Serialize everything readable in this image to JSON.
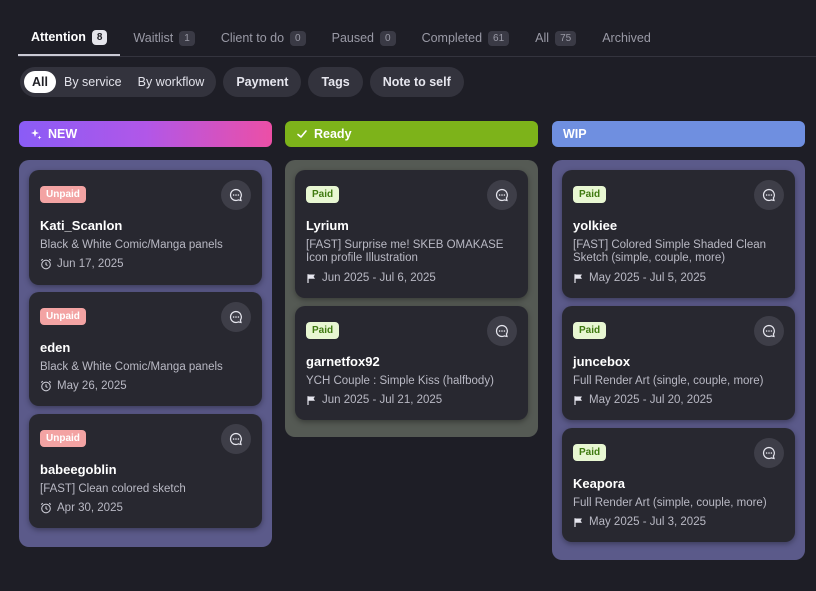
{
  "tabs": [
    {
      "label": "Attention",
      "count": "8",
      "active": true
    },
    {
      "label": "Waitlist",
      "count": "1"
    },
    {
      "label": "Client to do",
      "count": "0"
    },
    {
      "label": "Paused",
      "count": "0"
    },
    {
      "label": "Completed",
      "count": "61"
    },
    {
      "label": "All",
      "count": "75"
    },
    {
      "label": "Archived",
      "count": ""
    }
  ],
  "filters": {
    "segment": [
      "All",
      "By service",
      "By workflow"
    ],
    "pills": [
      "Payment",
      "Tags",
      "Note to self"
    ]
  },
  "columns": {
    "new": {
      "title": "NEW",
      "icon": "sparkle-icon",
      "cards": [
        {
          "badge": "Unpaid",
          "name": "Kati_Scanlon",
          "service": "Black & White Comic/Manga panels",
          "date": "Jun 17, 2025"
        },
        {
          "badge": "Unpaid",
          "name": "eden",
          "service": "Black & White Comic/Manga panels",
          "date": "May 26, 2025"
        },
        {
          "badge": "Unpaid",
          "name": "babeegoblin",
          "service": "[FAST] Clean colored sketch",
          "date": "Apr 30, 2025"
        }
      ]
    },
    "ready": {
      "title": "Ready",
      "icon": "check-icon",
      "cards": [
        {
          "badge": "Paid",
          "name": "Lyrium",
          "service": "[FAST] Surprise me! SKEB OMAKASE Icon profile Illustration",
          "date": "Jun 2025 - Jul 6, 2025"
        },
        {
          "badge": "Paid",
          "name": "garnetfox92",
          "service": "YCH Couple : Simple Kiss (halfbody)",
          "date": "Jun 2025 - Jul 21, 2025"
        }
      ]
    },
    "wip": {
      "title": "WIP",
      "cards": [
        {
          "badge": "Paid",
          "name": "yolkiee",
          "service": "[FAST] Colored Simple Shaded Clean Sketch (simple, couple, more)",
          "date": "May 2025 - Jul 5, 2025"
        },
        {
          "badge": "Paid",
          "name": "juncebox",
          "service": "Full Render Art (single, couple, more)",
          "date": "May 2025 - Jul 20, 2025"
        },
        {
          "badge": "Paid",
          "name": "Keapora",
          "service": "Full Render Art (simple, couple, more)",
          "date": "May 2025 - Jul 3, 2025"
        }
      ]
    }
  },
  "colors": {
    "ready_header": "#7db31a",
    "wip_header": "#6f8fe0",
    "unpaid_badge": "#f3a3a3",
    "paid_badge": "#e8f7d2"
  }
}
